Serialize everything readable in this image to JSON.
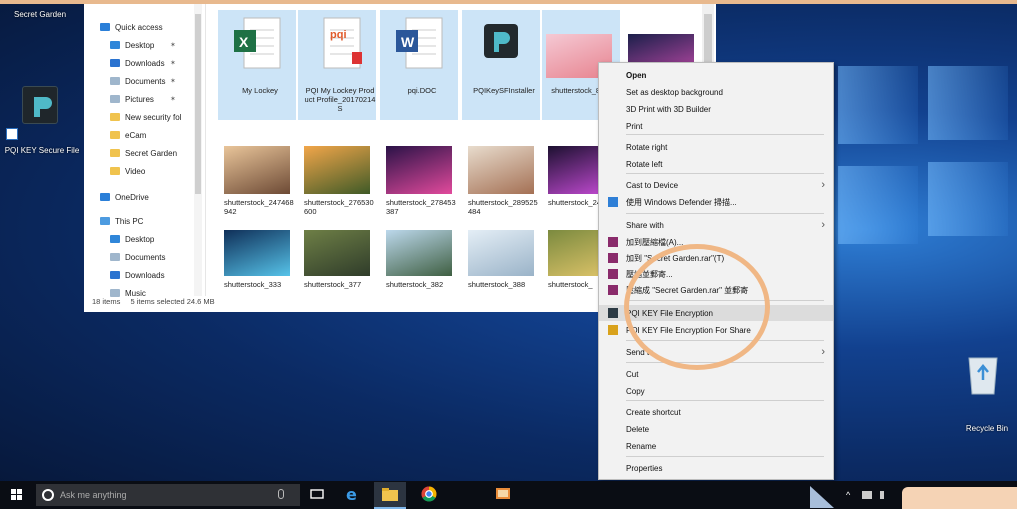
{
  "desktop": {
    "top_left_label": "Secret Garden",
    "shortcut_label": "PQI KEY Secure File",
    "recycle_label": "Recycle Bin"
  },
  "explorer": {
    "nav": [
      {
        "label": "Quick access",
        "icon": "star-icon",
        "color": "#2b7fd8"
      },
      {
        "label": "Desktop",
        "icon": "desktop-icon",
        "color": "#2f86d9",
        "pin": "✶"
      },
      {
        "label": "Downloads",
        "icon": "download-arrow-icon",
        "color": "#2a73d0",
        "pin": "✶"
      },
      {
        "label": "Documents",
        "icon": "document-icon",
        "color": "#9fb6cc",
        "pin": "✶"
      },
      {
        "label": "Pictures",
        "icon": "pictures-icon",
        "color": "#9fb6cc",
        "pin": "✶"
      },
      {
        "label": "New security fol",
        "icon": "folder-icon",
        "color": "#f0c34e"
      },
      {
        "label": "eCam",
        "icon": "folder-icon",
        "color": "#f0c34e"
      },
      {
        "label": "Secret Garden",
        "icon": "folder-icon",
        "color": "#f0c34e"
      },
      {
        "label": "Video",
        "icon": "folder-icon",
        "color": "#f0c34e"
      },
      {
        "label": "OneDrive",
        "icon": "cloud-icon",
        "color": "#2b7fd8"
      },
      {
        "label": "This PC",
        "icon": "computer-icon",
        "color": "#4d9be0"
      },
      {
        "label": "Desktop",
        "icon": "desktop-icon",
        "color": "#2f86d9"
      },
      {
        "label": "Documents",
        "icon": "document-icon",
        "color": "#9fb6cc"
      },
      {
        "label": "Downloads",
        "icon": "download-arrow-icon",
        "color": "#2a73d0"
      },
      {
        "label": "Music",
        "icon": "music-icon",
        "color": "#9fb6cc"
      }
    ],
    "files": [
      {
        "name": "My Lockey",
        "icon": "excel-file-icon",
        "selected": true
      },
      {
        "name": "PQI My Lockey Product Profile_20170214S",
        "icon": "pdf-file-icon",
        "selected": true
      },
      {
        "name": "pqi.DOC",
        "icon": "word-file-icon",
        "selected": true
      },
      {
        "name": "PQIKeySFInstaller",
        "icon": "pqi-app-icon",
        "selected": true
      },
      {
        "name": "shutterstock_87291",
        "icon": "gift-photo-icon",
        "selected": true
      },
      {
        "name": "",
        "icon": "night-photo-icon",
        "selected": false
      },
      {
        "name": "shutterstock_247468942",
        "icon": "people-photo-icon",
        "selected": false
      },
      {
        "name": "shutterstock_276530600",
        "icon": "sunset-photo-icon",
        "selected": false
      },
      {
        "name": "shutterstock_278453387",
        "icon": "fireworks-photo-icon",
        "selected": false
      },
      {
        "name": "shutterstock_289525484",
        "icon": "friends-photo-icon",
        "selected": false
      },
      {
        "name": "shutterstock_240020",
        "icon": "tower-photo-icon",
        "selected": false
      },
      {
        "name": "shutterstock_333",
        "icon": "aurora-photo-icon",
        "selected": false
      },
      {
        "name": "shutterstock_377",
        "icon": "road-photo-icon",
        "selected": false
      },
      {
        "name": "shutterstock_382",
        "icon": "hiker-photo-icon",
        "selected": false
      },
      {
        "name": "shutterstock_388",
        "icon": "selfie-photo-icon",
        "selected": false
      },
      {
        "name": "shutterstock_",
        "icon": "field-photo-icon",
        "selected": false
      }
    ],
    "status_items": "18 items",
    "status_selected": "5 items selected  24.6 MB"
  },
  "context_menu": {
    "items": [
      {
        "label": "Open",
        "bold": true
      },
      {
        "label": "Set as desktop background"
      },
      {
        "label": "3D Print with 3D Builder"
      },
      {
        "label": "Print"
      },
      {
        "label": "Rotate right"
      },
      {
        "label": "Rotate left"
      },
      {
        "label": "Cast to Device",
        "submenu": true
      },
      {
        "label": "使用 Windows Defender 掃描...",
        "icon": "defender-shield-icon"
      },
      {
        "label": "Share with",
        "submenu": true
      },
      {
        "label": "加到壓縮檔(A)...",
        "icon": "rar-archive-icon"
      },
      {
        "label": "加到 \"Secret Garden.rar\"(T)",
        "icon": "rar-archive-icon"
      },
      {
        "label": "壓縮並郵寄...",
        "icon": "rar-archive-icon"
      },
      {
        "label": "壓縮成 \"Secret Garden.rar\" 並郵寄",
        "icon": "rar-archive-icon"
      },
      {
        "label": "PQI KEY File Encryption",
        "icon": "pqi-lock-icon",
        "highlight": true
      },
      {
        "label": "PQI KEY File Encryption For Share",
        "icon": "pqi-share-lock-icon"
      },
      {
        "label": "Send to",
        "submenu": true
      },
      {
        "label": "Cut"
      },
      {
        "label": "Copy"
      },
      {
        "label": "Create shortcut"
      },
      {
        "label": "Delete"
      },
      {
        "label": "Rename"
      },
      {
        "label": "Properties"
      }
    ]
  },
  "taskbar": {
    "search_placeholder": "Ask me anything",
    "icons": [
      "windows-start-icon",
      "microphone-icon",
      "task-view-icon",
      "edge-icon",
      "file-explorer-icon",
      "chrome-icon",
      "photos-icon"
    ]
  },
  "colors": {
    "highlight_ring": "#f0b785",
    "selection": "#cce4f7"
  }
}
